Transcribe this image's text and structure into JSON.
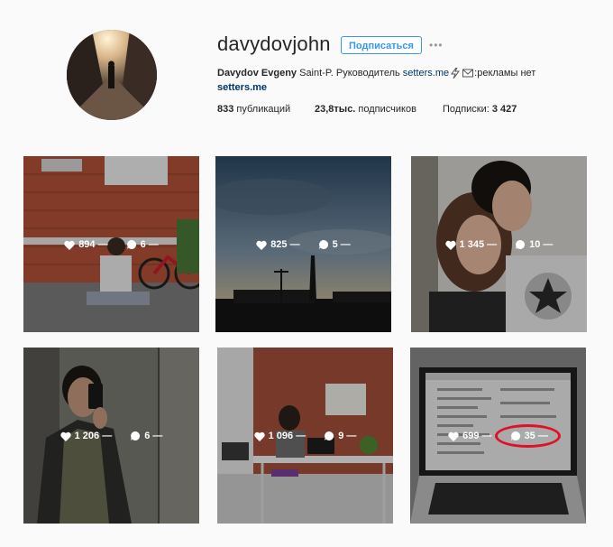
{
  "profile": {
    "username": "davydovjohn",
    "follow_label": "Подписаться",
    "more_label": "•••",
    "bio": {
      "name": "Davydov Evgeny",
      "text_1": " Saint-P. Руководитель ",
      "link_inline": "setters.me",
      "text_2": ":рекламы нет",
      "url": "setters.me"
    },
    "stats": {
      "posts_value": "833",
      "posts_label": " публикаций",
      "followers_value": "23,8тыс.",
      "followers_label": " подписчиков",
      "following_label": "Подписки: ",
      "following_value": "3 427"
    }
  },
  "posts": [
    {
      "likes": "894 —",
      "comments": "6 —"
    },
    {
      "likes": "825 —",
      "comments": "5 —"
    },
    {
      "likes": "1 345 —",
      "comments": "10 —"
    },
    {
      "likes": "1 206 —",
      "comments": "6 —"
    },
    {
      "likes": "1 096 —",
      "comments": "9 —"
    },
    {
      "likes": "699 —",
      "comments": "35 —"
    }
  ],
  "colors": {
    "follow": "#3897f0",
    "link": "#003569",
    "highlight_ring": "#e0102a"
  },
  "icons": [
    "heart-icon",
    "comment-icon",
    "lightning-icon",
    "envelope-icon"
  ]
}
